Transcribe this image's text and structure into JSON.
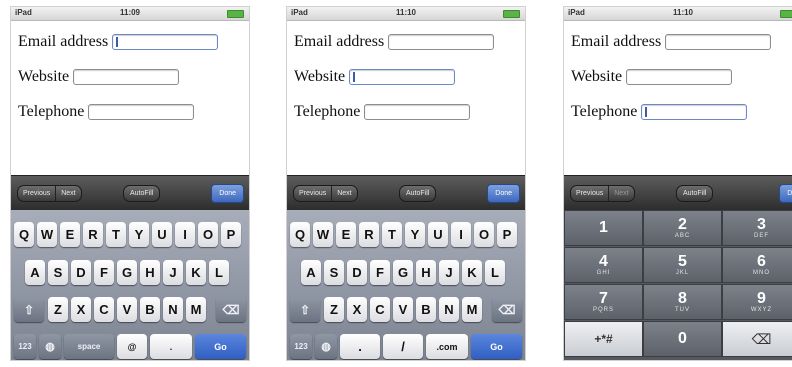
{
  "status": {
    "carrier": "iPad",
    "times": [
      "11:09",
      "11:10",
      "11:10"
    ]
  },
  "form": {
    "email_label": "Email address",
    "website_label": "Website",
    "telephone_label": "Telephone"
  },
  "toolbar": {
    "previous": "Previous",
    "next": "Next",
    "autofill": "AutoFill",
    "done": "Done"
  },
  "keyboard": {
    "row1": [
      "Q",
      "W",
      "E",
      "R",
      "T",
      "Y",
      "U",
      "I",
      "O",
      "P"
    ],
    "row2": [
      "A",
      "S",
      "D",
      "F",
      "G",
      "H",
      "J",
      "K",
      "L"
    ],
    "row3": [
      "Z",
      "X",
      "C",
      "V",
      "B",
      "N",
      "M"
    ],
    "email_bottom": [
      "123",
      "space",
      "@",
      ".",
      "Go"
    ],
    "url_bottom": [
      "123",
      ".",
      "/",
      ".com",
      "Go"
    ],
    "icons": {
      "shift": "shift-icon",
      "backspace": "backspace-icon",
      "globe": "globe-icon"
    }
  },
  "numpad": {
    "keys": [
      {
        "d": "1",
        "l": ""
      },
      {
        "d": "2",
        "l": "ABC"
      },
      {
        "d": "3",
        "l": "DEF"
      },
      {
        "d": "4",
        "l": "GHI"
      },
      {
        "d": "5",
        "l": "JKL"
      },
      {
        "d": "6",
        "l": "MNO"
      },
      {
        "d": "7",
        "l": "PQRS"
      },
      {
        "d": "8",
        "l": "TUV"
      },
      {
        "d": "9",
        "l": "WXYZ"
      }
    ],
    "symbols": "+*#",
    "zero": "0"
  },
  "colors": {
    "done_blue": "#3d68bf",
    "go_blue": "#2f5fc4",
    "keyboard_gray": "#7c8391"
  }
}
